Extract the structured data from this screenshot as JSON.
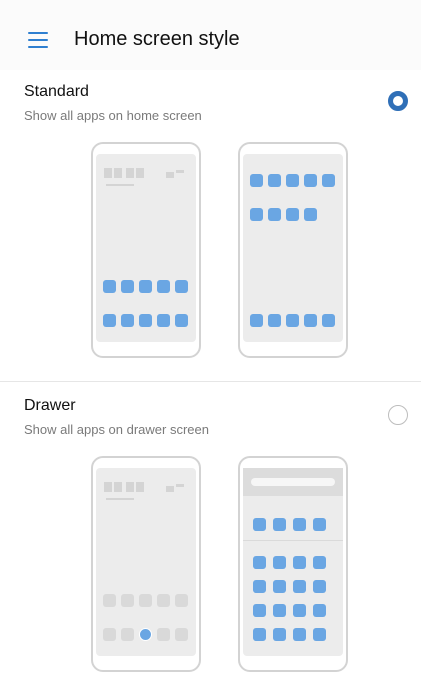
{
  "header": {
    "title": "Home screen style"
  },
  "options": [
    {
      "title": "Standard",
      "subtitle": "Show all apps on home screen",
      "selected": true
    },
    {
      "title": "Drawer",
      "subtitle": "Show all apps on drawer screen",
      "selected": false
    }
  ],
  "colors": {
    "accent": "#2f6fb7",
    "app_icon": "#6aa6e3"
  }
}
